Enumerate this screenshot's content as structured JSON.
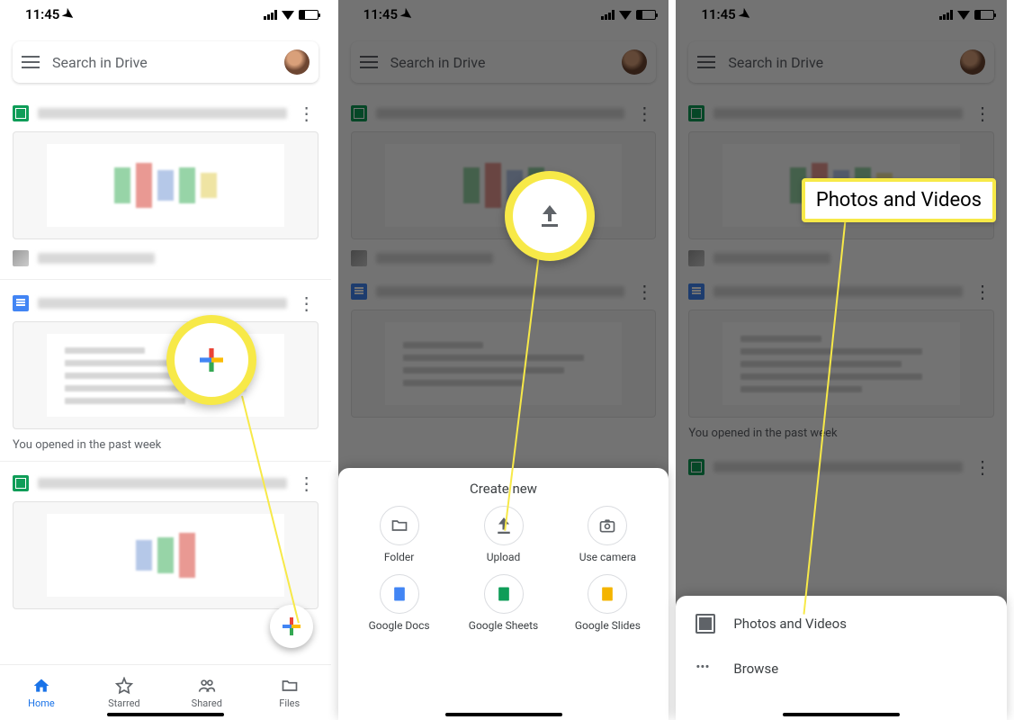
{
  "status": {
    "time": "11:45"
  },
  "search": {
    "placeholder": "Search in Drive"
  },
  "section_label": "You opened in the past week",
  "bottom_nav": {
    "home": "Home",
    "starred": "Starred",
    "shared": "Shared",
    "files": "Files"
  },
  "create_sheet": {
    "title": "Create new",
    "items": {
      "folder": "Folder",
      "upload": "Upload",
      "camera": "Use camera",
      "docs": "Google Docs",
      "sheets": "Google Sheets",
      "slides": "Google Slides"
    }
  },
  "upload_sheet": {
    "photos": "Photos and Videos",
    "browse": "Browse"
  },
  "callout": {
    "photos": "Photos and Videos"
  }
}
